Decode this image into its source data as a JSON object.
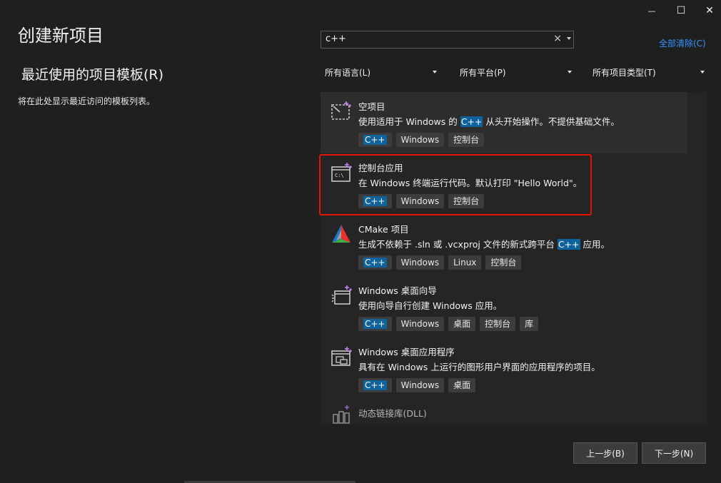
{
  "window": {
    "minimize_glyph": "—",
    "maximize_glyph": "☐",
    "close_glyph": "✕"
  },
  "title": "创建新项目",
  "recent": {
    "title": "最近使用的项目模板(R)",
    "description": "将在此处显示最近访问的模板列表。"
  },
  "search": {
    "value": "c++",
    "clear_glyph": "×"
  },
  "clear_all_label": "全部清除(C)",
  "filters": [
    {
      "label": "所有语言(L)"
    },
    {
      "label": "所有平台(P)"
    },
    {
      "label": "所有项目类型(T)"
    }
  ],
  "templates": [
    {
      "icon": "empty-project-icon",
      "name": "空项目",
      "desc_before": "使用适用于 Windows 的 ",
      "desc_highlight": "C++",
      "desc_after": " 从头开始操作。不提供基础文件。",
      "tags": [
        "C++",
        "Windows",
        "控制台"
      ]
    },
    {
      "icon": "console-app-icon",
      "name": "控制台应用",
      "desc_before": "在 Windows 终端运行代码。默认打印 \"Hello World\"。",
      "desc_highlight": "",
      "desc_after": "",
      "tags": [
        "C++",
        "Windows",
        "控制台"
      ]
    },
    {
      "icon": "cmake-icon",
      "name": "CMake 项目",
      "desc_before": "生成不依赖于 .sln 或 .vcxproj 文件的新式跨平台 ",
      "desc_highlight": "C++",
      "desc_after": " 应用。",
      "tags": [
        "C++",
        "Windows",
        "Linux",
        "控制台"
      ]
    },
    {
      "icon": "windows-wizard-icon",
      "name": "Windows 桌面向导",
      "desc_before": "使用向导自行创建 Windows 应用。",
      "desc_highlight": "",
      "desc_after": "",
      "tags": [
        "C++",
        "Windows",
        "桌面",
        "控制台",
        "库"
      ]
    },
    {
      "icon": "windows-desktop-app-icon",
      "name": "Windows 桌面应用程序",
      "desc_before": "具有在 Windows 上运行的图形用户界面的应用程序的项目。",
      "desc_highlight": "",
      "desc_after": "",
      "tags": [
        "C++",
        "Windows",
        "桌面"
      ]
    },
    {
      "icon": "dll-icon",
      "name": "动态链接库(DLL)"
    }
  ],
  "buttons": {
    "back": "上一步(B)",
    "next": "下一步(N)"
  },
  "colors": {
    "background": "#1f1f1f",
    "list_background": "#252526",
    "highlight": "#0e639c",
    "link": "#3794ff",
    "annotation_box": "#e51400"
  }
}
